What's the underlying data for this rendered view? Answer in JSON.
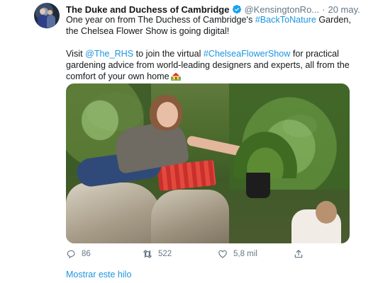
{
  "tweet": {
    "author_name": "The Duke and Duchess of Cambridge",
    "author_handle": "@KensingtonRo...",
    "separator": "·",
    "time": "20 may.",
    "paragraph1": {
      "pre": "One year on from The Duchess of Cambridge's ",
      "hashtag": "#BackToNature",
      "post": " Garden, the Chelsea Flower Show is going digital!"
    },
    "paragraph2": {
      "pre": "Visit ",
      "mention": "@The_RHS",
      "mid": " to join the virtual ",
      "hashtag": "#ChelseaFlowerShow",
      "post": " for practical gardening advice from world-leading designers and experts, all from the comfort of your own home"
    },
    "emoji_icon": "house-with-garden-icon",
    "colors": {
      "link": "#1b95e0",
      "verified": "#1da1f2",
      "muted": "#657786",
      "text": "#14171a"
    }
  },
  "actions": {
    "reply_count": "86",
    "retweet_count": "522",
    "like_count": "5,8 mil",
    "share_count": ""
  },
  "show_thread": "Mostrar este hilo"
}
